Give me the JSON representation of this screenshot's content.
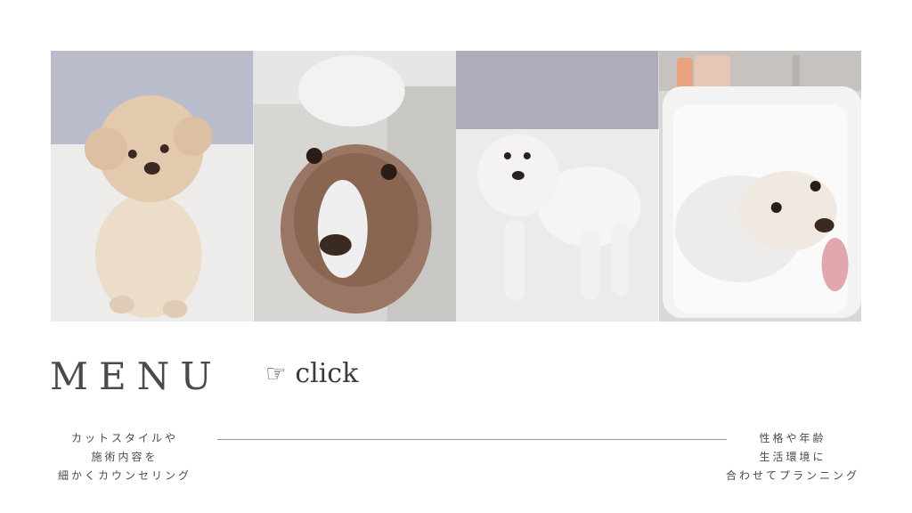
{
  "gallery": {
    "photos": [
      {
        "name": "apricot-toy-poodle-sitting"
      },
      {
        "name": "poodle-with-shampoo-foam"
      },
      {
        "name": "white-poodle-after-cut"
      },
      {
        "name": "poodle-in-bath-tub"
      }
    ]
  },
  "menu": {
    "title": "MENU",
    "link_icon": "pointing-hand-icon",
    "link_glyph": "☞",
    "link_label": "click"
  },
  "captions": {
    "left": [
      "カットスタイルや",
      "施術内容を",
      "細かくカウンセリング"
    ],
    "right": [
      "性格や年齢",
      "生活環境に",
      "合わせてプランニング"
    ]
  },
  "colors": {
    "background": "#ffffff",
    "text": "#4a4a4a",
    "divider": "#9a9a9a"
  }
}
